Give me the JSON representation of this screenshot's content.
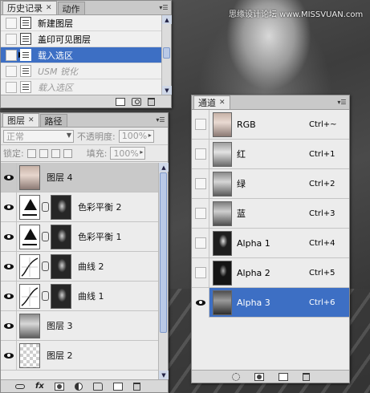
{
  "watermark": "思缘设计论坛 www.MISSVUAN.com",
  "colors": {
    "selection": "#3d6fc4",
    "panel_bg": "#e9e9e9",
    "tab_bar": "#c9c9c9"
  },
  "history": {
    "tabs": [
      {
        "label": "历史记录",
        "active": true
      },
      {
        "label": "动作",
        "active": false
      }
    ],
    "items": [
      {
        "label": "新建图层",
        "state": "normal",
        "icon": "history-step-icon"
      },
      {
        "label": "盖印可见图层",
        "state": "normal",
        "icon": "history-step-icon"
      },
      {
        "label": "载入选区",
        "state": "selected",
        "icon": "history-step-icon"
      },
      {
        "label": "USM 锐化",
        "state": "dimmed",
        "icon": "history-step-icon"
      },
      {
        "label": "载入选区",
        "state": "dimmed",
        "icon": "history-step-icon"
      }
    ],
    "footer_icons": [
      "new-document-from-state-icon",
      "snapshot-camera-icon",
      "trash-icon"
    ]
  },
  "layers": {
    "tabs": [
      {
        "label": "图层",
        "active": true
      },
      {
        "label": "路径",
        "active": false
      }
    ],
    "blend_mode": "正常",
    "opacity_label": "不透明度:",
    "opacity_value": "100%",
    "lock_label": "锁定:",
    "fill_label": "填充:",
    "fill_value": "100%",
    "items": [
      {
        "name": "图层 4",
        "thumb": "photo",
        "has_mask": false,
        "selected": true
      },
      {
        "name": "色彩平衡 2",
        "thumb": "color-balance",
        "has_mask": true,
        "selected": false
      },
      {
        "name": "色彩平衡 1",
        "thumb": "color-balance",
        "has_mask": true,
        "selected": false
      },
      {
        "name": "曲线 2",
        "thumb": "curves",
        "has_mask": true,
        "selected": false
      },
      {
        "name": "曲线 1",
        "thumb": "curves",
        "has_mask": true,
        "selected": false
      },
      {
        "name": "图层 3",
        "thumb": "photo-gray",
        "has_mask": false,
        "selected": false
      },
      {
        "name": "图层 2",
        "thumb": "transparent",
        "has_mask": false,
        "selected": false
      }
    ],
    "footer_icons": [
      "link-layers-icon",
      "fx-icon",
      "add-mask-icon",
      "adjustment-layer-icon",
      "new-group-icon",
      "new-layer-icon",
      "trash-icon"
    ]
  },
  "channels": {
    "tabs": [
      {
        "label": "通道",
        "active": true
      }
    ],
    "items": [
      {
        "name": "RGB",
        "shortcut": "Ctrl+~",
        "thumb": "rgb",
        "visible": false,
        "selected": false
      },
      {
        "name": "红",
        "shortcut": "Ctrl+1",
        "thumb": "red",
        "visible": false,
        "selected": false
      },
      {
        "name": "绿",
        "shortcut": "Ctrl+2",
        "thumb": "green",
        "visible": false,
        "selected": false
      },
      {
        "name": "蓝",
        "shortcut": "Ctrl+3",
        "thumb": "blue",
        "visible": false,
        "selected": false
      },
      {
        "name": "Alpha 1",
        "shortcut": "Ctrl+4",
        "thumb": "alpha1",
        "visible": false,
        "selected": false
      },
      {
        "name": "Alpha 2",
        "shortcut": "Ctrl+5",
        "thumb": "alpha2",
        "visible": false,
        "selected": false
      },
      {
        "name": "Alpha 3",
        "shortcut": "Ctrl+6",
        "thumb": "alpha3",
        "visible": true,
        "selected": true
      }
    ],
    "footer_icons": [
      "load-selection-icon",
      "save-selection-icon",
      "new-channel-icon",
      "trash-icon"
    ]
  }
}
